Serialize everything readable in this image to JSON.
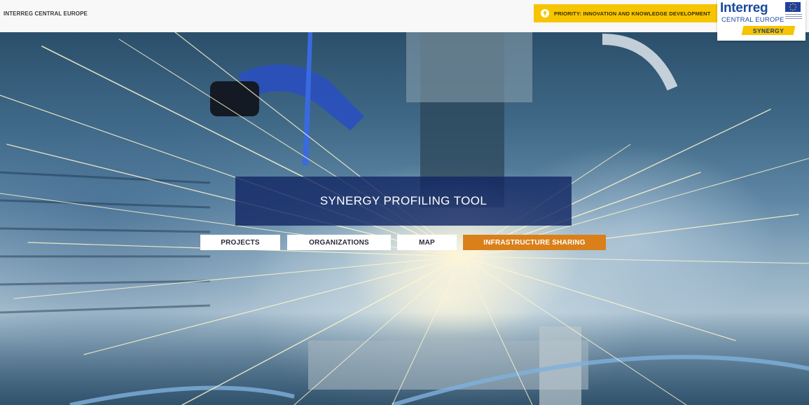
{
  "header": {
    "brand": "INTERREG CENTRAL EUROPE",
    "priority": "PRIORITY: INNOVATION AND KNOWLEDGE DEVELOPMENT",
    "priority_color": "#f7c500",
    "priority_icon": "lightbulb-icon"
  },
  "logo": {
    "interreg": "Interreg",
    "sub": "CENTRAL EUROPE",
    "badge": "SYNERGY",
    "flag_icon": "eu-flag-icon"
  },
  "hero": {
    "title": "SYNERGY PROFILING TOOL",
    "nav": [
      {
        "label": "PROJECTS"
      },
      {
        "label": "ORGANIZATIONS"
      },
      {
        "label": "MAP"
      },
      {
        "label": "INFRASTRUCTURE SHARING"
      }
    ],
    "accent_color": "#d9801a",
    "title_bg": "#142864"
  }
}
